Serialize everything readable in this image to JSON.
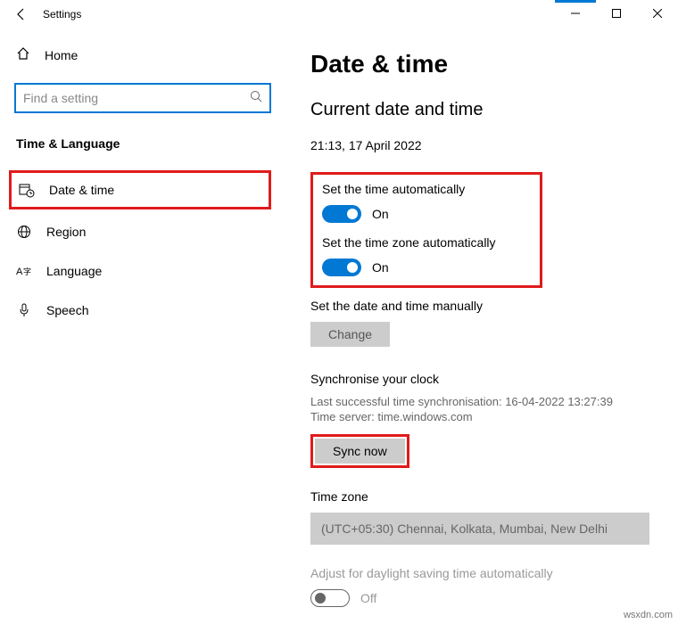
{
  "window": {
    "title": "Settings"
  },
  "sidebar": {
    "home": "Home",
    "search_placeholder": "Find a setting",
    "category": "Time & Language",
    "items": [
      {
        "label": "Date & time"
      },
      {
        "label": "Region"
      },
      {
        "label": "Language"
      },
      {
        "label": "Speech"
      }
    ]
  },
  "content": {
    "title": "Date & time",
    "subtitle": "Current date and time",
    "datetime": "21:13, 17 April 2022",
    "auto_time": {
      "label": "Set the time automatically",
      "state": "On"
    },
    "auto_tz": {
      "label": "Set the time zone automatically",
      "state": "On"
    },
    "manual": {
      "label": "Set the date and time manually",
      "button": "Change"
    },
    "sync": {
      "title": "Synchronise your clock",
      "last": "Last successful time synchronisation: 16-04-2022 13:27:39",
      "server": "Time server: time.windows.com",
      "button": "Sync now"
    },
    "tz": {
      "title": "Time zone",
      "value": "(UTC+05:30) Chennai, Kolkata, Mumbai, New Delhi"
    },
    "dst": {
      "label": "Adjust for daylight saving time automatically",
      "state": "Off"
    }
  },
  "watermark": "wsxdn.com"
}
